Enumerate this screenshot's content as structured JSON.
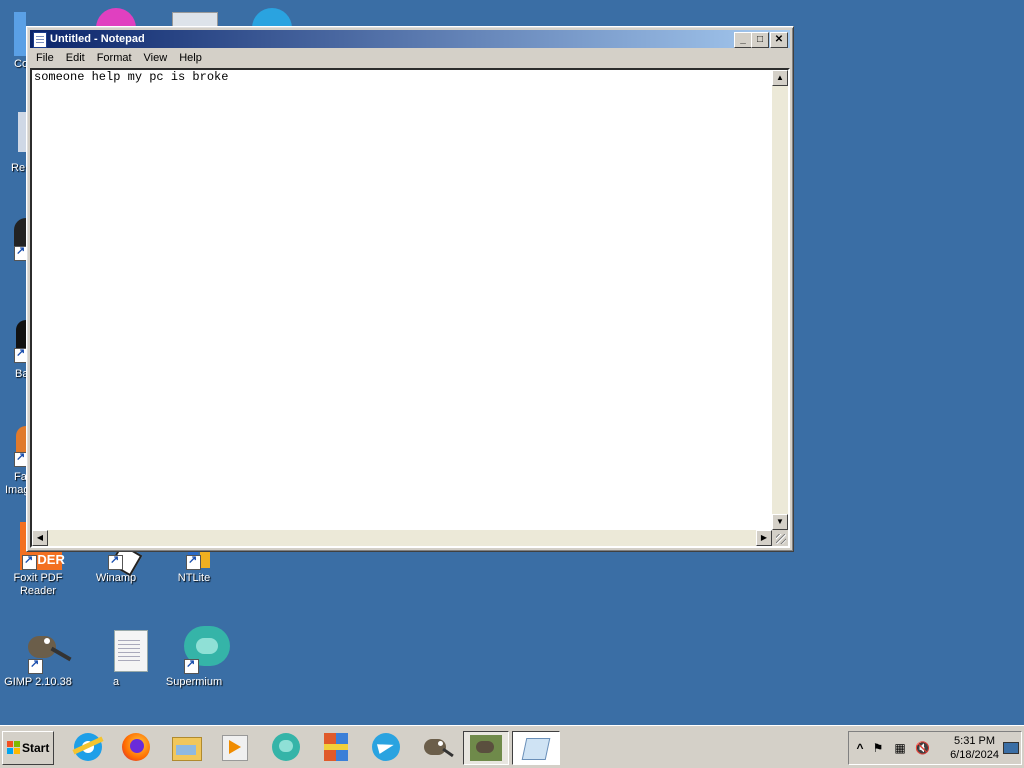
{
  "desktop": {
    "partial_labels": [
      "Co",
      "Re",
      "Ba",
      "Fa",
      "Imag"
    ],
    "icons": [
      {
        "label_line1": "Foxit PDF",
        "label_line2": "Reader",
        "icon": "foxit-reader-icon"
      },
      {
        "label_line1": "Winamp",
        "label_line2": "",
        "icon": "winamp-icon"
      },
      {
        "label_line1": "NTLite",
        "label_line2": "",
        "icon": "ntlite-icon"
      },
      {
        "label_line1": "GIMP 2.10.38",
        "label_line2": "",
        "icon": "gimp-icon"
      },
      {
        "label_line1": "a",
        "label_line2": "",
        "icon": "text-file-icon"
      },
      {
        "label_line1": "Supermium",
        "label_line2": "",
        "icon": "supermium-icon"
      }
    ]
  },
  "window": {
    "title": "Untitled - Notepad",
    "menu": [
      "File",
      "Edit",
      "Format",
      "View",
      "Help"
    ],
    "content": "someone help my pc is broke",
    "controls": {
      "minimize": "_",
      "maximize": "□",
      "close": "✕"
    }
  },
  "taskbar": {
    "start_label": "Start",
    "pinned": [
      "internet-explorer-icon",
      "firefox-icon",
      "file-explorer-icon",
      "media-player-icon",
      "supermium-icon",
      "winrar-icon",
      "telegram-icon",
      "gimp-icon",
      "gimp-app-icon",
      "notepad-icon"
    ],
    "tray": {
      "time": "5:31 PM",
      "date": "6/18/2024",
      "show_hidden": "^"
    }
  },
  "colors": {
    "desktop": "#3a6ea5",
    "titlebar_start": "#0a246a",
    "titlebar_end": "#a6caf0",
    "taskbar": "#d4d0c8"
  }
}
